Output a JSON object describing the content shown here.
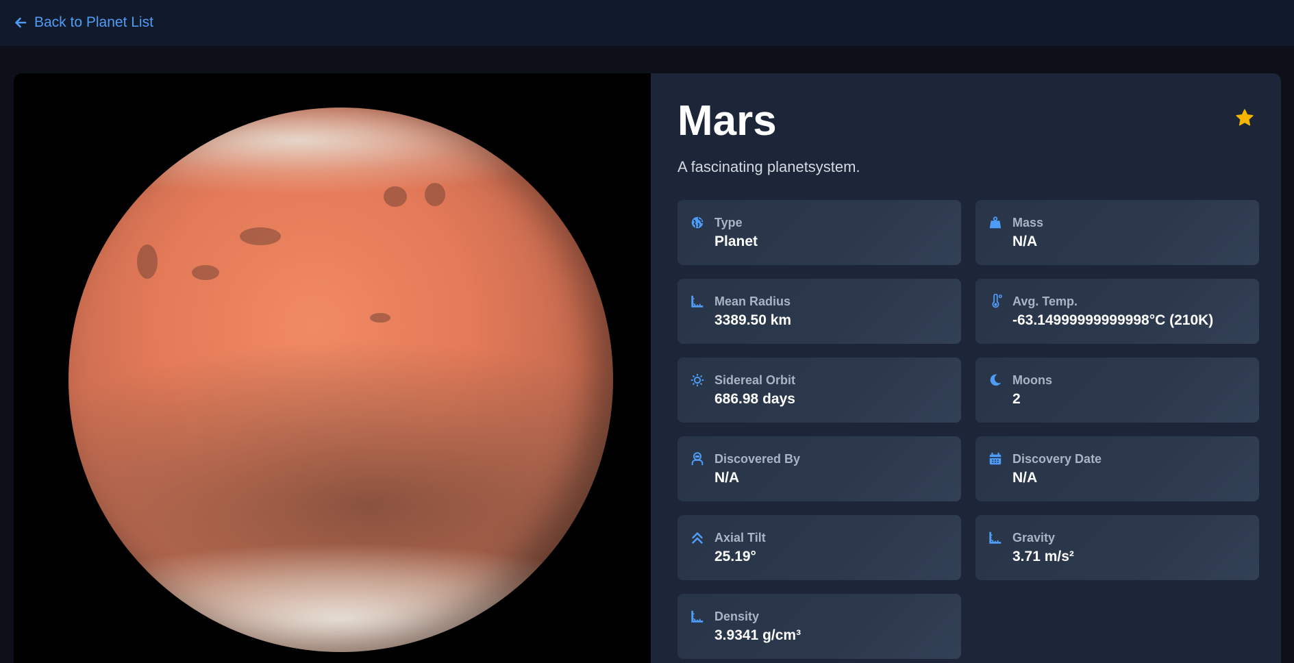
{
  "nav": {
    "back_label": "Back to Planet List"
  },
  "planet": {
    "name": "Mars",
    "description": "A fascinating planetsystem.",
    "favorite": true
  },
  "colors": {
    "accent": "#4f9cf7",
    "favorite_star": "#f5b400",
    "card_bg": "#1c2638",
    "stat_bg": "#2a3649",
    "topbar_bg": "#111a2b"
  },
  "stats": [
    {
      "icon": "globe-icon",
      "label": "Type",
      "value": "Planet"
    },
    {
      "icon": "weight-icon",
      "label": "Mass",
      "value": "N/A"
    },
    {
      "icon": "ruler-icon",
      "label": "Mean Radius",
      "value": "3389.50 km"
    },
    {
      "icon": "thermometer-icon",
      "label": "Avg. Temp.",
      "value": "-63.14999999999998°C (210K)"
    },
    {
      "icon": "sun-icon",
      "label": "Sidereal Orbit",
      "value": "686.98 days"
    },
    {
      "icon": "moon-icon",
      "label": "Moons",
      "value": "2"
    },
    {
      "icon": "astronaut-icon",
      "label": "Discovered By",
      "value": "N/A"
    },
    {
      "icon": "calendar-icon",
      "label": "Discovery Date",
      "value": "N/A"
    },
    {
      "icon": "chevrons-up-icon",
      "label": "Axial Tilt",
      "value": "25.19°"
    },
    {
      "icon": "ruler-icon",
      "label": "Gravity",
      "value": "3.71 m/s²"
    },
    {
      "icon": "ruler-icon",
      "label": "Density",
      "value": "3.9341 g/cm³"
    }
  ]
}
